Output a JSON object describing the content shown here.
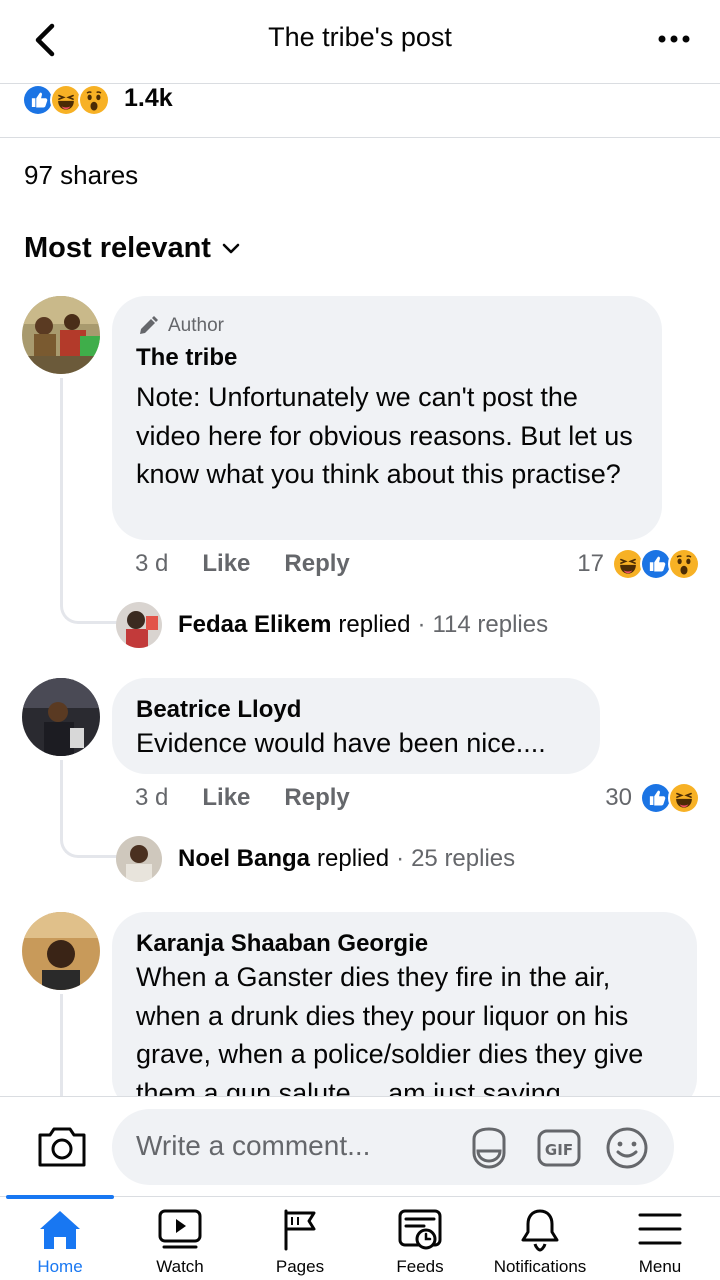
{
  "header": {
    "title": "The tribe's post"
  },
  "post_stats": {
    "reaction_count": "1.4k",
    "shares": "97 shares"
  },
  "sort": {
    "label": "Most relevant"
  },
  "comments": [
    {
      "badge": "Author",
      "name": "The tribe",
      "text": "Note: Unfortunately we can't post the video here for obvious reasons. But let us know what you think about this practise?",
      "time": "3 d",
      "like": "Like",
      "reply": "Reply",
      "reaction_count": "17",
      "replies_preview": {
        "name": "Fedaa Elikem",
        "verb": "replied",
        "count": "114 replies"
      }
    },
    {
      "name": "Beatrice Lloyd",
      "text": "Evidence would have been nice....",
      "time": "3 d",
      "like": "Like",
      "reply": "Reply",
      "reaction_count": "30",
      "replies_preview": {
        "name": "Noel Banga",
        "verb": "replied",
        "count": "25 replies"
      }
    },
    {
      "name": "Karanja Shaaban Georgie",
      "text": "When a Ganster dies they fire in the air, when a drunk dies they pour liquor on his grave, when a police/soldier dies they give them a gun salute.... am just saying"
    }
  ],
  "composer": {
    "placeholder": "Write a comment..."
  },
  "nav": {
    "items": [
      {
        "label": "Home",
        "icon": "home-icon"
      },
      {
        "label": "Watch",
        "icon": "watch-icon"
      },
      {
        "label": "Pages",
        "icon": "flag-icon"
      },
      {
        "label": "Feeds",
        "icon": "feeds-icon"
      },
      {
        "label": "Notifications",
        "icon": "bell-icon"
      },
      {
        "label": "Menu",
        "icon": "menu-icon"
      }
    ]
  },
  "colors": {
    "accent": "#1877f2",
    "bubble": "#f0f2f5",
    "secondary_text": "#65676b"
  }
}
